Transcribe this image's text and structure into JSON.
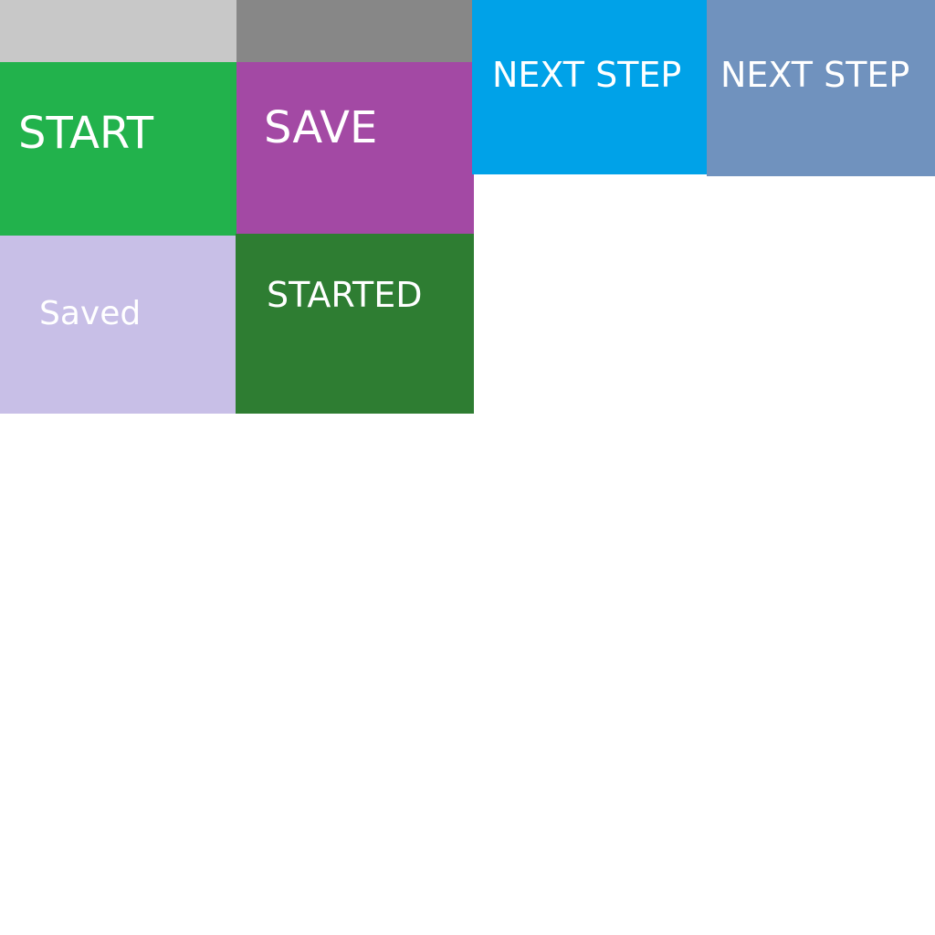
{
  "tiles": {
    "gray_light": {
      "color": "#c8c8c8"
    },
    "gray_dark": {
      "color": "#878787"
    },
    "start": {
      "label": "START",
      "color": "#22b24c"
    },
    "save": {
      "label": "SAVE",
      "color": "#a349a4"
    },
    "next_1": {
      "label": "NEXT STEP",
      "color": "#00a2e8"
    },
    "next_2": {
      "label": "NEXT STEP",
      "color": "#7092be"
    },
    "saved": {
      "label": "Saved",
      "color": "#c8bfe7"
    },
    "started": {
      "label": "STARTED",
      "color": "#2e7d32"
    }
  }
}
